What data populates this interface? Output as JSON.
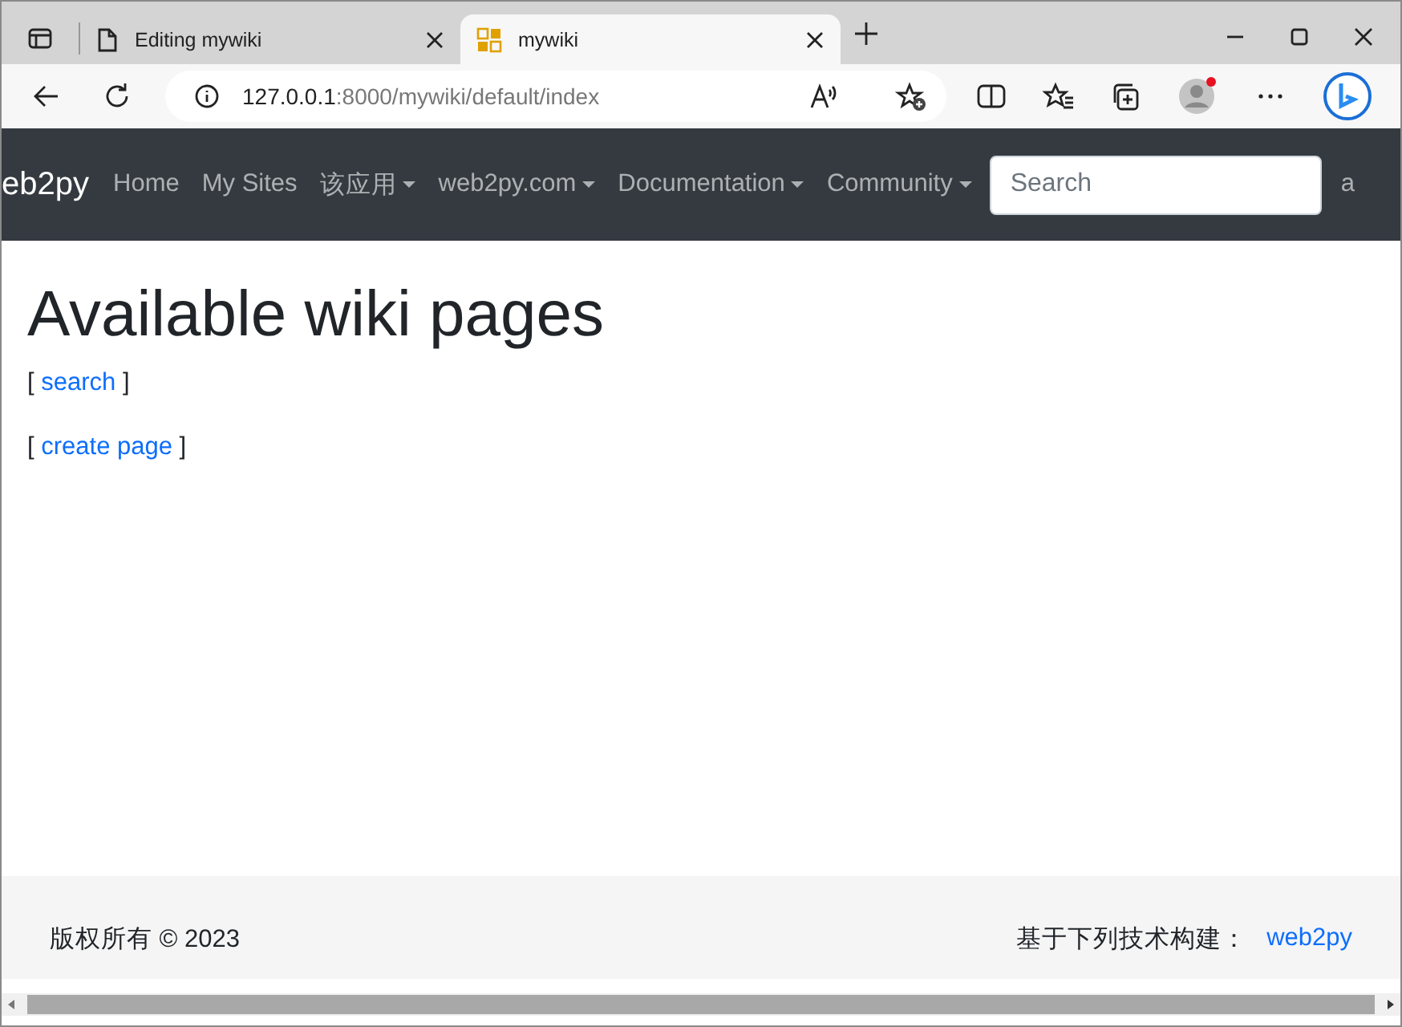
{
  "browser": {
    "tabs": [
      {
        "title": "Editing mywiki",
        "kind": "page",
        "selected": false
      },
      {
        "title": "mywiki",
        "kind": "app",
        "selected": true
      }
    ],
    "url_host": "127.0.0.1",
    "url_rest": ":8000/mywiki/default/index"
  },
  "navbar": {
    "brand": "eb2py",
    "items": [
      {
        "label": "Home",
        "dropdown": false
      },
      {
        "label": "My Sites",
        "dropdown": false
      },
      {
        "label": "该应用",
        "dropdown": true
      },
      {
        "label": "web2py.com",
        "dropdown": true
      },
      {
        "label": "Documentation",
        "dropdown": true
      },
      {
        "label": "Community",
        "dropdown": true
      }
    ],
    "search": {
      "placeholder": "Search"
    },
    "trailing": "a"
  },
  "main": {
    "title": "Available wiki pages",
    "links": [
      {
        "open": "[",
        "label": "search",
        "close": "]"
      },
      {
        "open": "[",
        "label": "create page",
        "close": "]"
      }
    ]
  },
  "footer": {
    "copyright": "版权所有 © 2023",
    "powered_label": "基于下列技术构建：",
    "powered_link": "web2py"
  }
}
